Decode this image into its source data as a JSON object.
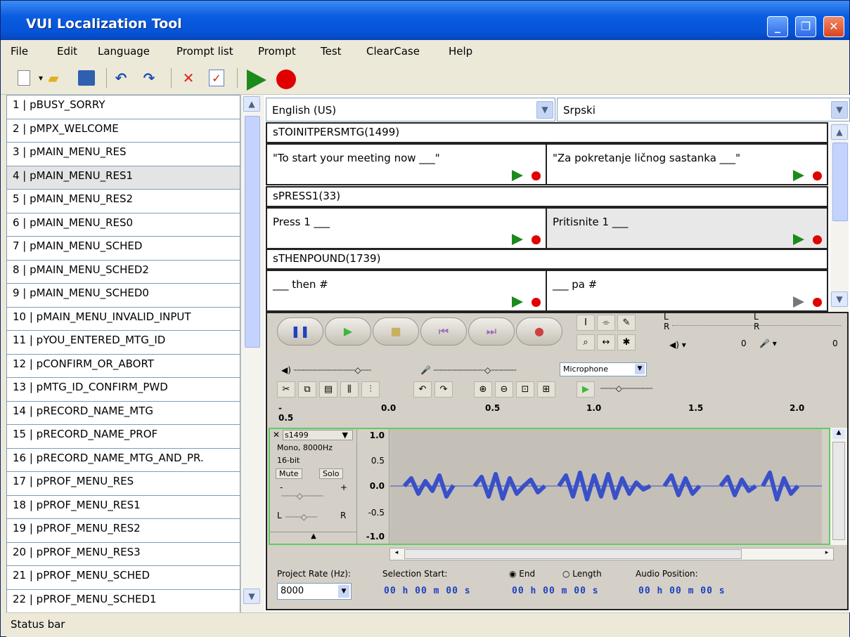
{
  "window": {
    "title": "VUI Localization Tool",
    "min_label": "_",
    "max_label": "❐",
    "close_label": "✕"
  },
  "menu": [
    "File",
    "Edit",
    "Language",
    "Prompt list",
    "Prompt",
    "Test",
    "ClearCase",
    "Help"
  ],
  "toolbar_icons": [
    "new-file-icon",
    "dropdown-icon",
    "open-folder-icon",
    "save-icon",
    "undo-icon",
    "redo-icon",
    "delete-icon",
    "checkmark-icon",
    "play-icon",
    "record-icon"
  ],
  "prompts": [
    "1 | pBUSY_SORRY",
    "2 | pMPX_WELCOME",
    "3 | pMAIN_MENU_RES",
    "4 | pMAIN_MENU_RES1",
    "5 | pMAIN_MENU_RES2",
    "6 | pMAIN_MENU_RES0",
    "7 | pMAIN_MENU_SCHED",
    "8 | pMAIN_MENU_SCHED2",
    "9 | pMAIN_MENU_SCHED0",
    "10 | pMAIN_MENU_INVALID_INPUT",
    "11 | pYOU_ENTERED_MTG_ID",
    "12 | pCONFIRM_OR_ABORT",
    "13 | pMTG_ID_CONFIRM_PWD",
    "14 | pRECORD_NAME_MTG",
    "15 | pRECORD_NAME_PROF",
    "16 | pRECORD_NAME_MTG_AND_PR.",
    "17 | pPROF_MENU_RES",
    "18 | pPROF_MENU_RES1",
    "19 | pPROF_MENU_RES2",
    "20 | pPROF_MENU_RES3",
    "21 | pPROF_MENU_SCHED",
    "22 | pPROF_MENU_SCHED1"
  ],
  "selected_index": 3,
  "languages": {
    "source": "English (US)",
    "target": "Srpski"
  },
  "segments": [
    {
      "id": "sTOINITPERSMTG(1499)",
      "source": "\"To start your meeting now ___\"",
      "target": "\"Za pokretanje ličnog sastanka ___\""
    },
    {
      "id": "sPRESS1(33)",
      "source": "Press 1  ___",
      "target": "Pritisnite 1 ___"
    },
    {
      "id": "sTHENPOUND(1739)",
      "source": "___ then #",
      "target": "___ pa #"
    }
  ],
  "audio": {
    "input_source": "Microphone",
    "ruler": [
      "- 0.5",
      "0.0",
      "0.5",
      "1.0",
      "1.5",
      "2.0"
    ],
    "track": {
      "name": "s1499",
      "info1": "Mono, 8000Hz",
      "info2": "16-bit",
      "mute": "Mute",
      "solo": "Solo",
      "gain_minus": "-",
      "gain_plus": "+",
      "pan_l": "L",
      "pan_r": "R"
    },
    "yaxis": [
      "1.0",
      "0.5",
      "0.0",
      "-0.5",
      "-1.0"
    ],
    "meter_l": "L",
    "meter_r": "R",
    "meter_zero": "0",
    "project_rate_label": "Project Rate (Hz):",
    "project_rate": "8000",
    "sel_start_label": "Selection Start:",
    "end_label": "End",
    "length_label": "Length",
    "audio_pos_label": "Audio Position:",
    "time_value": "00 h 00 m 00 s"
  },
  "status": "Status bar"
}
